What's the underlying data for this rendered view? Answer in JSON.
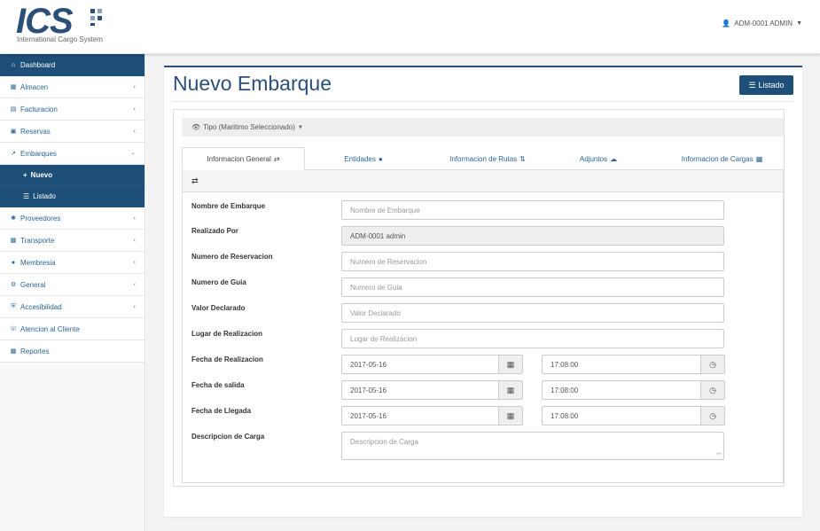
{
  "header": {
    "logo_text": "ICS",
    "logo_subtitle": "International Cargo System",
    "user": "ADM-0001 ADMIN",
    "user_icon": "user-icon",
    "caret_icon": "caret-down-icon"
  },
  "sidebar": {
    "items": [
      {
        "label": "Dashboard",
        "icon": "home-icon"
      },
      {
        "label": "Almacen",
        "icon": "cubes-icon"
      },
      {
        "label": "Facturacion",
        "icon": "file-icon"
      },
      {
        "label": "Reservas",
        "icon": "calendar-icon"
      },
      {
        "label": "Embarques",
        "icon": "external-link-icon"
      },
      {
        "label": "Proveedores",
        "icon": "asterisk-icon"
      },
      {
        "label": "Transporte",
        "icon": "bus-icon"
      },
      {
        "label": "Membresia",
        "icon": "user-icon"
      },
      {
        "label": "General",
        "icon": "gears-icon"
      },
      {
        "label": "Accesibilidad",
        "icon": "shield-icon"
      },
      {
        "label": "Atencion al Cliente",
        "icon": "phone-icon"
      },
      {
        "label": "Reportes",
        "icon": "bar-chart-icon"
      }
    ],
    "subitems": [
      {
        "label": "Nuevo",
        "icon": "plus-icon"
      },
      {
        "label": "Listado",
        "icon": "list-icon"
      }
    ]
  },
  "main": {
    "title": "Nuevo Embarque",
    "listado_button": "Listado",
    "type_selector": "Tipo (Maritimo Seleccionado)",
    "tabs": [
      {
        "label": "Informacion General",
        "icon": "exchange-icon"
      },
      {
        "label": "Entidades",
        "icon": "users-icon"
      },
      {
        "label": "Informacion de Rutas",
        "icon": "random-icon"
      },
      {
        "label": "Adjuntos",
        "icon": "cloud-upload-icon"
      },
      {
        "label": "Informacion de Cargas",
        "icon": "cubes-icon"
      }
    ],
    "tab_panel_icon": "exchange-icon"
  },
  "form": {
    "nombre": {
      "label": "Nombre de Embarque",
      "placeholder": "Nombre de Embarque"
    },
    "realizado": {
      "label": "Realizado Por",
      "value": "ADM-0001 admin"
    },
    "reservacion": {
      "label": "Numero de Reservacion",
      "placeholder": "Numero de Reservacion"
    },
    "guia": {
      "label": "Numero de Guia",
      "placeholder": "Numero de Guia"
    },
    "valor": {
      "label": "Valor Declarado",
      "placeholder": "Valor Declarado"
    },
    "lugar": {
      "label": "Lugar de Realizacion",
      "placeholder": "Lugar de Realizacion"
    },
    "fecha_realizacion": {
      "label": "Fecha de Realizacion",
      "date": "2017-05-16",
      "time": "17:08:00"
    },
    "fecha_salida": {
      "label": "Fecha de salida",
      "date": "2017-05-16",
      "time": "17:08:00"
    },
    "fecha_llegada": {
      "label": "Fecha de Llegada",
      "date": "2017-05-16",
      "time": "17:08:00"
    },
    "descripcion": {
      "label": "Descripcion de Carga",
      "placeholder": "Descripcion de Carga"
    }
  }
}
